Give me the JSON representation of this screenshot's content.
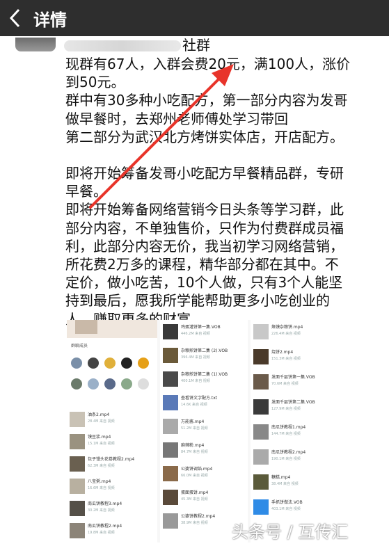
{
  "header": {
    "title": "详情"
  },
  "post": {
    "group_suffix": "社群",
    "paragraphs": [
      "现群有67人，入群会费20元，满100人，涨价\n到50元。",
      "群中有30多种小吃配方，第一部分内容为发哥\n做早餐时，去郑州老师傅处学习带回\n第二部分为武汉北方烤饼实体店，开店配方。",
      "即将开始筹备发哥小吃配方早餐精品群，专研\n早餐。",
      "即将开始筹备网络营销今日头条等学习群，此\n部分内容，不单独售价，只作为付费群成员福\n利，此部分内容无价，我当初学习网络营销，\n所花费2万多的课程，精华部分都在其中。不\n定价，做小吃苦，10个人做，只有3个人能坚\n持到最后，愿我所学能帮助更多小吃创业的\n人，赚取更多的财富。"
    ]
  },
  "screenshot": {
    "members_label": "群聊成员",
    "col_a": [
      {
        "name": "油条2.mp4",
        "meta": "28.4M 来自 视频"
      },
      {
        "name": "馍豆浆.mp4",
        "meta": "15.1M 来自 视频"
      },
      {
        "name": "包子馒头花卷教程2.mp4",
        "meta": "62.3M 来自 视频"
      },
      {
        "name": "八宝粥.mp4",
        "meta": "16.6M 来自 视频"
      },
      {
        "name": "南瓜饼教程3.mp4",
        "meta": "30.2M 来自 视频"
      },
      {
        "name": "南瓜饼教程2.mp4",
        "meta": "19.8M 来自 视频"
      }
    ],
    "col_b": [
      {
        "name": "鸡蛋灌饼第一集.VOB",
        "meta": "446.2M 来自 视频"
      },
      {
        "name": "杂粮煎饼第二集 (2).VOB",
        "meta": "396.4M 来自 视频"
      },
      {
        "name": "杂粮煎饼第二集 (1).VOB",
        "meta": "400.1M 来自 视频"
      },
      {
        "name": "查看饼文字配方.txt",
        "meta": "14.6K 来自 视频"
      },
      {
        "name": "万能酱.mp4",
        "meta": "51.2M 来自 视频"
      },
      {
        "name": "麻辣粉.mp4",
        "meta": "84.7M 来自 视频"
      },
      {
        "name": "公婆饼调馅.mp4",
        "meta": "66.0M 来自 视频"
      },
      {
        "name": "蛋面蛋饼.mp4",
        "meta": "45.3M 来自 视频"
      },
      {
        "name": "公婆饼教程2.mp4",
        "meta": "38.9M 来自 视频"
      }
    ],
    "col_c": [
      {
        "name": "烙馍杂粮饼.mp4",
        "meta": "226.4M 来自 视频"
      },
      {
        "name": "烧饼2.mp4",
        "meta": "151.3M 来自 视频"
      },
      {
        "name": "发面千层饼第一集.VOB",
        "meta": "70.6M 来自 视频"
      },
      {
        "name": "发面千层饼第二集.VOB",
        "meta": "127.9M 来自 视频"
      },
      {
        "name": "南瓜饼教程1.mp4",
        "meta": "144.7M 来自 视频"
      },
      {
        "name": "南瓜饼教程2.mp4",
        "meta": "190.1M 来自 视频"
      },
      {
        "name": "糖糕.mp4",
        "meta": "38.4M 来自 视频"
      },
      {
        "name": "手抓饼做法.VOB",
        "meta": "403.1M 来自 视频"
      }
    ]
  },
  "watermark": "头条号 / 互传汇",
  "colors": {
    "header_bg": "#2e2e2e",
    "arrow": "#e8342a"
  }
}
